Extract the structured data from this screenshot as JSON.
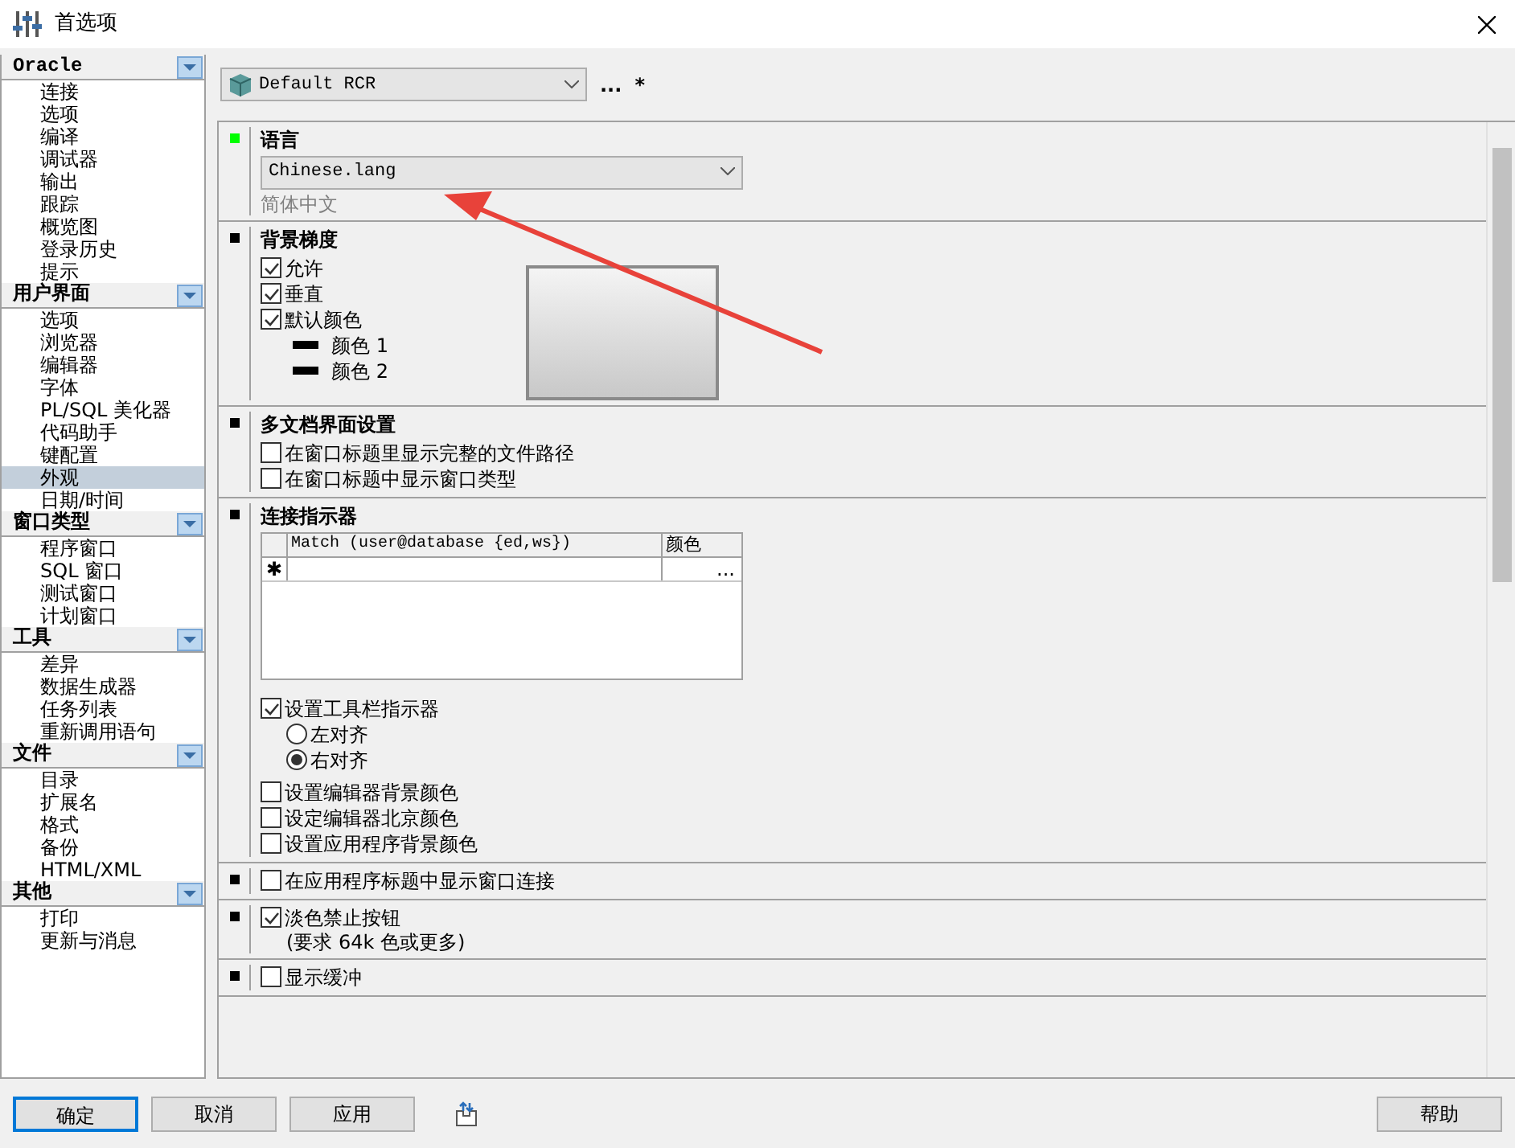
{
  "window": {
    "title": "首选项"
  },
  "sidebar": {
    "groups": [
      {
        "title": "Oracle",
        "items": [
          {
            "label": "连接",
            "selected": false
          },
          {
            "label": "选项",
            "selected": false
          },
          {
            "label": "编译",
            "selected": false
          },
          {
            "label": "调试器",
            "selected": false
          },
          {
            "label": "输出",
            "selected": false
          },
          {
            "label": "跟踪",
            "selected": false
          },
          {
            "label": "概览图",
            "selected": false
          },
          {
            "label": "登录历史",
            "selected": false
          },
          {
            "label": "提示",
            "selected": false
          }
        ]
      },
      {
        "title": "用户界面",
        "items": [
          {
            "label": "选项",
            "selected": false
          },
          {
            "label": "浏览器",
            "selected": false
          },
          {
            "label": "编辑器",
            "selected": false
          },
          {
            "label": "字体",
            "selected": false
          },
          {
            "label": "PL/SQL 美化器",
            "selected": false
          },
          {
            "label": "代码助手",
            "selected": false
          },
          {
            "label": "键配置",
            "selected": false
          },
          {
            "label": "外观",
            "selected": true
          },
          {
            "label": "日期/时间",
            "selected": false
          }
        ]
      },
      {
        "title": "窗口类型",
        "items": [
          {
            "label": "程序窗口",
            "selected": false
          },
          {
            "label": "SQL 窗口",
            "selected": false
          },
          {
            "label": "测试窗口",
            "selected": false
          },
          {
            "label": "计划窗口",
            "selected": false
          }
        ]
      },
      {
        "title": "工具",
        "items": [
          {
            "label": "差异",
            "selected": false
          },
          {
            "label": "数据生成器",
            "selected": false
          },
          {
            "label": "任务列表",
            "selected": false
          },
          {
            "label": "重新调用语句",
            "selected": false
          }
        ]
      },
      {
        "title": "文件",
        "items": [
          {
            "label": "目录",
            "selected": false
          },
          {
            "label": "扩展名",
            "selected": false
          },
          {
            "label": "格式",
            "selected": false
          },
          {
            "label": "备份",
            "selected": false
          },
          {
            "label": "HTML/XML",
            "selected": false
          }
        ]
      },
      {
        "title": "其他",
        "items": [
          {
            "label": "打印",
            "selected": false
          },
          {
            "label": "更新与消息",
            "selected": false
          }
        ]
      }
    ]
  },
  "toolbar": {
    "profile": "Default RCR",
    "more": "...",
    "modified": "*"
  },
  "sections": [
    {
      "kind": "language",
      "selected": true,
      "title": "语言",
      "value": "Chinese.lang",
      "note": "简体中文"
    },
    {
      "kind": "gradient",
      "selected": false,
      "title": "背景梯度",
      "options": [
        {
          "label": "允许",
          "checked": true
        },
        {
          "label": "垂直",
          "checked": true
        },
        {
          "label": "默认颜色",
          "checked": true
        }
      ],
      "colors": [
        {
          "label": "颜色 1",
          "color": "#000000"
        },
        {
          "label": "颜色 2",
          "color": "#000000"
        }
      ]
    },
    {
      "kind": "checks",
      "selected": false,
      "title": "多文档界面设置",
      "options": [
        {
          "label": "在窗口标题里显示完整的文件路径",
          "checked": false
        },
        {
          "label": "在窗口标题中显示窗口类型",
          "checked": false
        }
      ]
    },
    {
      "kind": "connection",
      "selected": false,
      "title": "连接指示器",
      "columns": [
        "Match (user@database {ed,ws})",
        "颜色"
      ],
      "new_row": "✱",
      "cell_button": "...",
      "toolbar_option": {
        "label": "设置工具栏指示器",
        "checked": true
      },
      "radios": [
        {
          "label": "左对齐",
          "selected": false
        },
        {
          "label": "右对齐",
          "selected": true
        }
      ],
      "options": [
        {
          "label": "设置编辑器背景颜色",
          "checked": false
        },
        {
          "label": "设定编辑器北京颜色",
          "checked": false
        },
        {
          "label": "设置应用程序背景颜色",
          "checked": false
        }
      ]
    },
    {
      "kind": "checks",
      "selected": false,
      "options": [
        {
          "label": "在应用程序标题中显示窗口连接",
          "checked": false
        }
      ]
    },
    {
      "kind": "checks",
      "selected": false,
      "options": [
        {
          "label": "淡色禁止按钮",
          "note": "(要求 64k 色或更多)",
          "checked": true
        }
      ]
    },
    {
      "kind": "checks",
      "selected": false,
      "options": [
        {
          "label": "显示缓冲",
          "checked": false
        }
      ]
    }
  ],
  "buttons": [
    {
      "label": "确定",
      "default": true
    },
    {
      "label": "取消",
      "default": false
    },
    {
      "label": "应用",
      "default": false
    }
  ],
  "help": "帮助"
}
